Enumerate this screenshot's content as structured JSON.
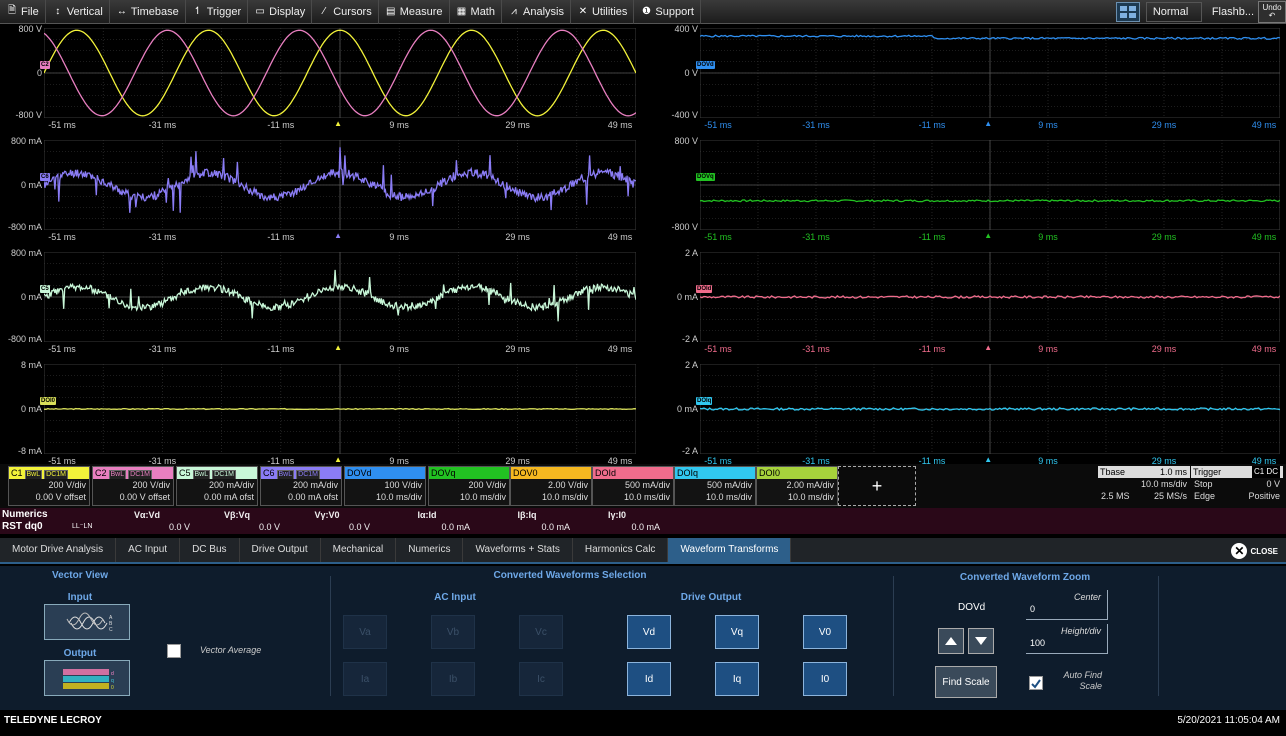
{
  "menu": {
    "items": [
      {
        "icon": "file-icon",
        "glyph": "🗎",
        "label": "File"
      },
      {
        "icon": "vertical-icon",
        "glyph": "↕",
        "label": "Vertical"
      },
      {
        "icon": "timebase-icon",
        "glyph": "↔",
        "label": "Timebase"
      },
      {
        "icon": "trigger-icon",
        "glyph": "↿",
        "label": "Trigger"
      },
      {
        "icon": "display-icon",
        "glyph": "▭",
        "label": "Display"
      },
      {
        "icon": "cursors-icon",
        "glyph": "⁄",
        "label": "Cursors"
      },
      {
        "icon": "measure-icon",
        "glyph": "▤",
        "label": "Measure"
      },
      {
        "icon": "math-icon",
        "glyph": "▦",
        "label": "Math"
      },
      {
        "icon": "analysis-icon",
        "glyph": "⩘",
        "label": "Analysis"
      },
      {
        "icon": "utilities-icon",
        "glyph": "✕",
        "label": "Utilities"
      },
      {
        "icon": "support-icon",
        "glyph": "❶",
        "label": "Support"
      }
    ],
    "mode": "Normal",
    "flash": "Flashb...",
    "undo": "Undo"
  },
  "time_axis": {
    "labels": [
      "-51 ms",
      "-31 ms",
      "-11 ms",
      "9 ms",
      "29 ms",
      "49 ms"
    ]
  },
  "grids": {
    "left": [
      {
        "ytop": "800 V",
        "ymid": "0",
        "ybot": "-800 V",
        "badges": [
          {
            "text": "C2",
            "color": "#e87fc0"
          }
        ]
      },
      {
        "ytop": "800 mA",
        "ymid": "0 mA",
        "ybot": "-800 mA",
        "badges": [
          {
            "text": "C6",
            "color": "#8a7cf5"
          }
        ]
      },
      {
        "ytop": "800 mA",
        "ymid": "0 mA",
        "ybot": "-800 mA",
        "badges": [
          {
            "text": "C5",
            "color": "#c8f7d8"
          }
        ]
      },
      {
        "ytop": "8 mA",
        "ymid": "0 mA",
        "ybot": "-8 mA",
        "badges": [
          {
            "text": "DOI0",
            "color": "#d9e05a"
          }
        ]
      }
    ],
    "right": [
      {
        "ytop": "400 V",
        "ymid": "0 V",
        "ybot": "-400 V",
        "badges": [
          {
            "text": "DOVd",
            "color": "#2f8ff0"
          }
        ]
      },
      {
        "ytop": "800 V",
        "ymid": "",
        "ybot": "-800 V",
        "badges": [
          {
            "text": "DOVq",
            "color": "#22c222"
          }
        ]
      },
      {
        "ytop": "2 A",
        "ymid": "0 mA",
        "ybot": "-2 A",
        "badges": [
          {
            "text": "DOId",
            "color": "#f06c8c"
          }
        ]
      },
      {
        "ytop": "2 A",
        "ymid": "0 mA",
        "ybot": "-2 A",
        "badges": [
          {
            "text": "DOIq",
            "color": "#31c8f0"
          }
        ]
      }
    ]
  },
  "channels": [
    {
      "name": "C1",
      "color": "#f2f23a",
      "tags": [
        "BwL",
        "DC1M"
      ],
      "v1": "200 V/div",
      "v2": "0.00 V offset"
    },
    {
      "name": "C2",
      "color": "#e87fc0",
      "tags": [
        "BwL",
        "DC1M"
      ],
      "v1": "200 V/div",
      "v2": "0.00 V offset"
    },
    {
      "name": "C5",
      "color": "#c8f7d8",
      "tags": [
        "BwL",
        "DC1M"
      ],
      "v1": "200 mA/div",
      "v2": "0.00 mA ofst"
    },
    {
      "name": "C6",
      "color": "#8a7cf5",
      "tags": [
        "BwL",
        "DC1M"
      ],
      "v1": "200 mA/div",
      "v2": "0.00 mA ofst"
    },
    {
      "name": "DOVd",
      "color": "#2f8ff0",
      "tags": [],
      "v1": "100 V/div",
      "v2": "10.0 ms/div"
    },
    {
      "name": "DOVq",
      "color": "#22c222",
      "tags": [],
      "v1": "200 V/div",
      "v2": "10.0 ms/div"
    },
    {
      "name": "DOV0",
      "color": "#f5b820",
      "tags": [],
      "v1": "2.00 V/div",
      "v2": "10.0 ms/div"
    },
    {
      "name": "DOId",
      "color": "#f06c8c",
      "tags": [],
      "v1": "500 mA/div",
      "v2": "10.0 ms/div"
    },
    {
      "name": "DOIq",
      "color": "#31c8f0",
      "tags": [],
      "v1": "500 mA/div",
      "v2": "10.0 ms/div"
    },
    {
      "name": "DOI0",
      "color": "#a6d23c",
      "tags": [],
      "v1": "2.00 mA/div",
      "v2": "10.0 ms/div"
    }
  ],
  "add_label": "+",
  "tbase": {
    "title": "Tbase",
    "value": "1.0 ms",
    "row1": "10.0 ms/div",
    "row2a": "2.5 MS",
    "row2b": "25 MS/s"
  },
  "trigger": {
    "title": "Trigger",
    "badge": "C1 DC",
    "row1a": "Stop",
    "row1b": "0 V",
    "row2a": "Edge",
    "row2b": "Positive"
  },
  "numerics": {
    "title": "Numerics",
    "row": "RST dq0",
    "mode": "LL⁻LN",
    "headers": [
      "Vα:Vd",
      "Vβ:Vq",
      "Vγ:V0",
      "Iα:Id",
      "Iβ:Iq",
      "Iγ:I0"
    ],
    "values": [
      "0.0 V",
      "0.0 V",
      "0.0 V",
      "0.0 mA",
      "0.0 mA",
      "0.0 mA"
    ]
  },
  "tabs": [
    "Motor Drive Analysis",
    "AC Input",
    "DC Bus",
    "Drive Output",
    "Mechanical",
    "Numerics",
    "Waveforms + Stats",
    "Harmonics Calc",
    "Waveform Transforms"
  ],
  "active_tab": "Waveform Transforms",
  "close_label": "CLOSE",
  "panel": {
    "vector_view": "Vector View",
    "input": "Input",
    "output": "Output",
    "vector_average": "Vector Average",
    "converted_title": "Converted Waveforms Selection",
    "ac_input": "AC Input",
    "drive_output": "Drive Output",
    "ac_v": [
      "Va",
      "Vb",
      "Vc"
    ],
    "ac_i": [
      "Ia",
      "Ib",
      "Ic"
    ],
    "do_v": [
      "Vd",
      "Vq",
      "V0"
    ],
    "do_i": [
      "Id",
      "Iq",
      "I0"
    ],
    "zoom_title": "Converted Waveform Zoom",
    "zoom_target": "DOVd",
    "center_label": "Center",
    "center_value": "0",
    "height_label": "Height/div",
    "height_value": "100",
    "find_scale": "Find Scale",
    "auto_find": "Auto Find Scale"
  },
  "footer": {
    "brand": "TELEDYNE LECROY",
    "timestamp": "5/20/2021 11:05:04 AM"
  }
}
